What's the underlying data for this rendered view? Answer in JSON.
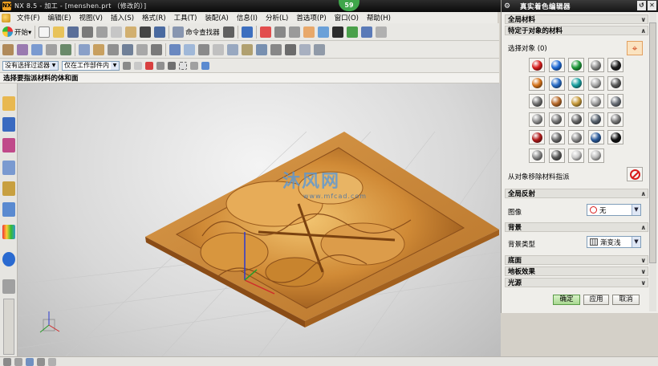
{
  "title_bar": {
    "logo": "nx-logo",
    "title": "NX 8.5 - 加工 - [menshen.prt （修改的）]",
    "badge": "59"
  },
  "menu": [
    "文件(F)",
    "编辑(E)",
    "视图(V)",
    "插入(S)",
    "格式(R)",
    "工具(T)",
    "装配(A)",
    "信息(I)",
    "分析(L)",
    "首选项(P)",
    "窗口(O)",
    "帮助(H)"
  ],
  "toolbar": {
    "start_label": "开始▾",
    "command_finder_label": "命令查找器"
  },
  "selection_bar": {
    "filter_value": "没有选择过滤器",
    "scope_value": "仅在工作部件内"
  },
  "prompt": "选择要指派材料的体和面",
  "watermark": {
    "text": "沐风网",
    "url": "www.mfcad.com"
  },
  "dialog": {
    "title": "真实着色编辑器",
    "sections": {
      "global_materials": "全局材料",
      "object_materials": "特定于对象的材料",
      "global_reflection": "全局反射",
      "background": "背景",
      "floor": "底面",
      "floor_effect": "地板效果",
      "lights": "光源"
    },
    "select_object_label": "选择对象 (0)",
    "remove_material_label": "从对象移除材料指派",
    "image_label": "图像",
    "image_value": "无",
    "bg_type_label": "背景类型",
    "bg_type_value": "渐变浅",
    "buttons": {
      "ok": "确定",
      "apply": "应用",
      "cancel": "取消"
    },
    "material_colors": [
      [
        "#d81e1e",
        "#1f6ad6",
        "#1f9a3a",
        "#8c8c8c",
        "#1e1e1e"
      ],
      [
        "#d6741c",
        "#2a6ec8",
        "#1aa0a0",
        "#a8a8a8",
        "#5a5a5a"
      ],
      [
        "#707070",
        "#b86a2a",
        "#c79a3a",
        "#a0a0a0",
        "#6a7078"
      ],
      [
        "#909090",
        "#787878",
        "#686868",
        "#5a6470",
        "#7a7a7a"
      ],
      [
        "#b01a1a",
        "#6a6a6a",
        "#8a8a8a",
        "#2a5a9a",
        "#111111"
      ],
      [
        "#8a8a8a",
        "#5a5a5a",
        "#c8c8c8",
        "#b8b8b8"
      ]
    ]
  }
}
